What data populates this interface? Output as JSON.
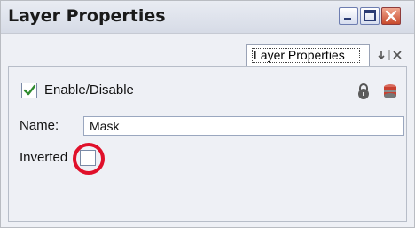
{
  "window": {
    "title": "Layer Properties"
  },
  "tabs": [
    {
      "label": "Layer Properties",
      "active": true
    }
  ],
  "panel": {
    "enable_label": "Enable/Disable",
    "enable_checked": true,
    "name_label": "Name:",
    "name_value": "Mask",
    "inverted_label": "Inverted",
    "inverted_checked": false
  },
  "icons": {
    "lock": "lock-icon",
    "database": "database-icon",
    "minimize": "minimize-icon",
    "maximize": "maximize-icon",
    "close": "close-icon",
    "tab_menu": "tab-menu-icon",
    "tab_close": "tab-close-icon"
  },
  "colors": {
    "highlight": "#e0102a",
    "check": "#2e8b2e"
  }
}
